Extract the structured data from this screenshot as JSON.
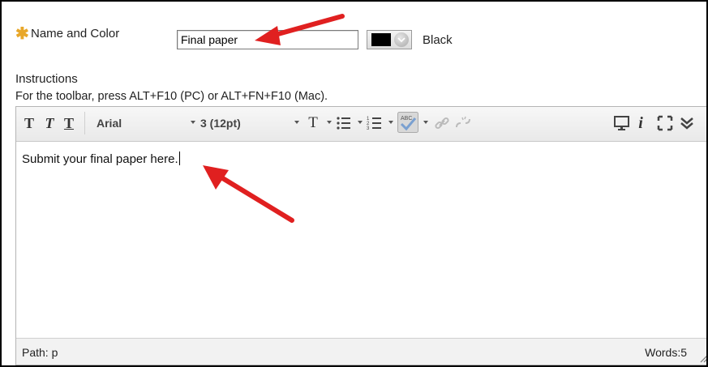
{
  "form": {
    "required_marker": "✱",
    "name_label": "Name and Color",
    "name_value": "Final paper",
    "color_name": "Black",
    "color_hex": "#000000",
    "instructions_label": "Instructions",
    "toolbar_hint": "For the toolbar, press ALT+F10 (PC) or ALT+FN+F10 (Mac)."
  },
  "editor": {
    "toolbar": {
      "bold_glyph": "T",
      "italic_glyph": "T",
      "underline_glyph": "T",
      "font_family": "Arial",
      "font_size": "3 (12pt)",
      "text_color_glyph": "T",
      "icons": [
        "bold-icon",
        "italic-icon",
        "underline-icon",
        "text-color-icon",
        "bullet-list-icon",
        "numbered-list-icon",
        "spellcheck-icon",
        "insert-link-icon",
        "unlink-icon",
        "preview-icon",
        "info-icon",
        "fullscreen-icon",
        "expand-toolbar-icon"
      ]
    },
    "content": "Submit your final paper here.",
    "status": {
      "path": "Path: p",
      "words": "Words:5"
    }
  },
  "colors": {
    "annotation_arrow": "#e02020",
    "required_star": "#e8a72a"
  }
}
